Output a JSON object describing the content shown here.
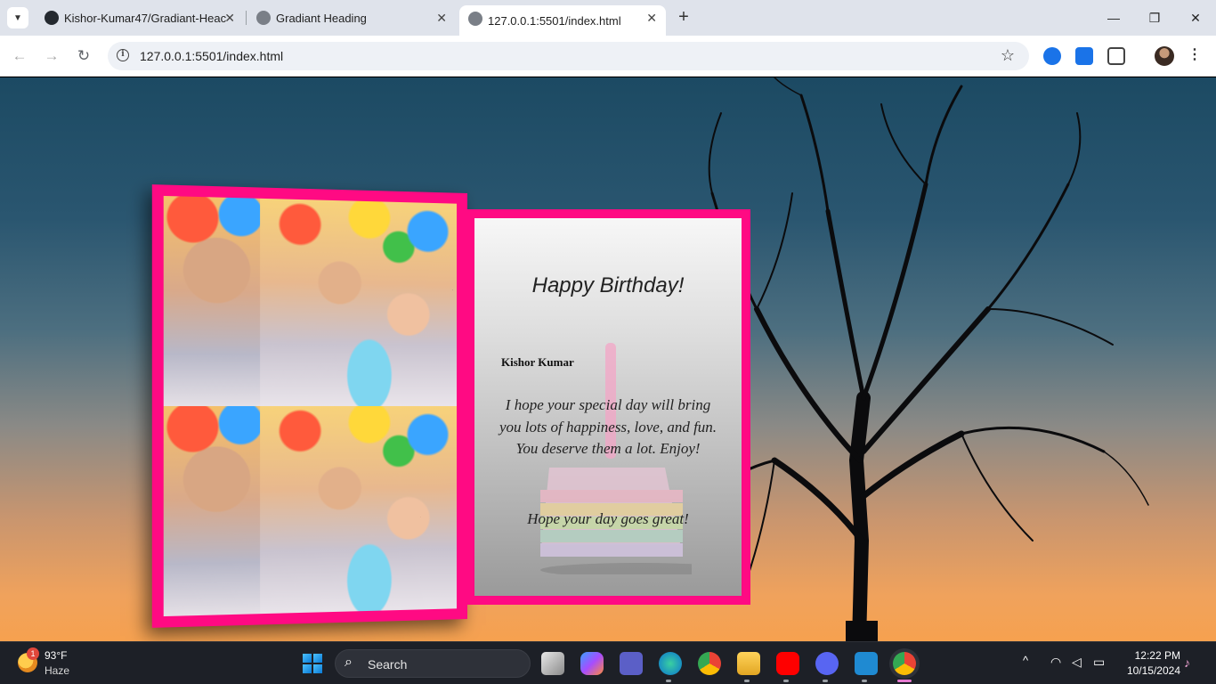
{
  "browser": {
    "tabs": [
      {
        "title": "Kishor-Kumar47/Gradiant-Heac",
        "active": false
      },
      {
        "title": "Gradiant Heading",
        "active": false
      },
      {
        "title": "127.0.0.1:5501/index.html",
        "active": true
      }
    ],
    "close_glyph": "✕",
    "new_tab_glyph": "+",
    "url": "127.0.0.1:5501/index.html",
    "window_controls": {
      "minimize": "—",
      "restore": "❐",
      "close": "✕"
    },
    "nav": {
      "back": "←",
      "forward": "→",
      "reload": "↻"
    },
    "info_glyph": "i",
    "star_glyph": "☆",
    "menu_glyph": "⋮"
  },
  "card": {
    "title": "Happy Birthday!",
    "name": "Kishor Kumar",
    "message": "I hope your special day will bring you lots of happiness, love, and fun. You deserve them a lot. Enjoy!",
    "closing": "Hope your day goes great!",
    "border_color": "#ff0a83"
  },
  "taskbar": {
    "weather": {
      "temp": "93°F",
      "condition": "Haze",
      "badge": "1"
    },
    "search_label": "Search",
    "clock": {
      "time": "12:22 PM",
      "date": "10/15/2024"
    },
    "apps": [
      "task-view",
      "copilot",
      "teams",
      "edge",
      "chrome",
      "file-explorer",
      "youtube",
      "discord",
      "vscode",
      "chrome-profile"
    ]
  }
}
